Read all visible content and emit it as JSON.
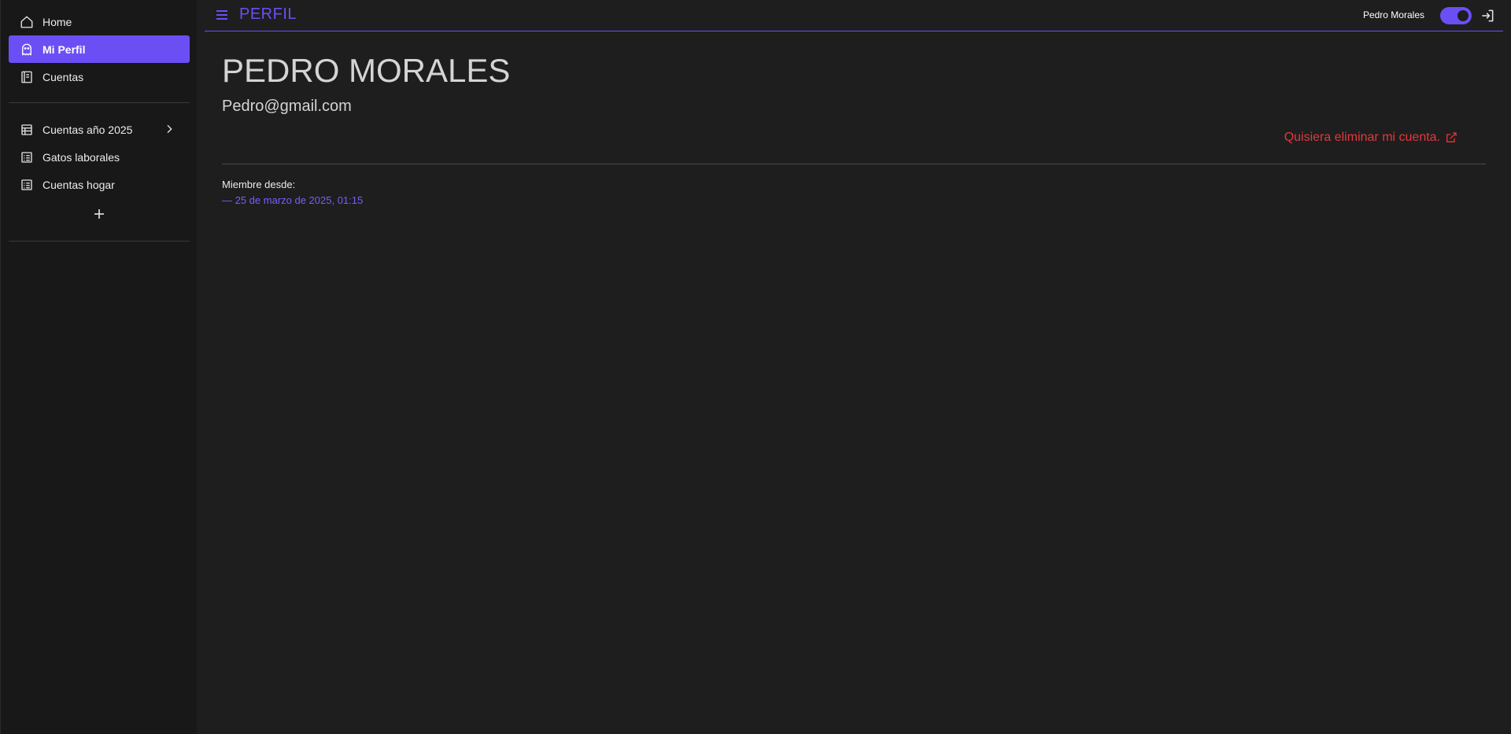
{
  "sidebar": {
    "items": [
      {
        "label": "Home",
        "icon": "home-icon"
      },
      {
        "label": "Mi Perfil",
        "icon": "ghost-icon",
        "active": true
      },
      {
        "label": "Cuentas",
        "icon": "notebook-icon"
      }
    ],
    "sheets": [
      {
        "label": "Cuentas año 2025",
        "icon": "table-icon"
      },
      {
        "label": "Gatos laborales",
        "icon": "list-icon"
      },
      {
        "label": "Cuentas hogar",
        "icon": "list-icon"
      }
    ]
  },
  "header": {
    "title": "PERFIL",
    "user_name": "Pedro Morales",
    "theme_toggle_on": true
  },
  "profile": {
    "name": "PEDRO MORALES",
    "email": "Pedro@gmail.com",
    "delete_link": "Quisiera eliminar mi cuenta.",
    "member_since_label": "Miembre desde:",
    "member_since_value": "— 25 de marzo de 2025, 01:15"
  },
  "colors": {
    "accent": "#6b4ff5",
    "danger": "#e0393e",
    "background": "#1e1e1e",
    "sidebar": "#181818"
  }
}
